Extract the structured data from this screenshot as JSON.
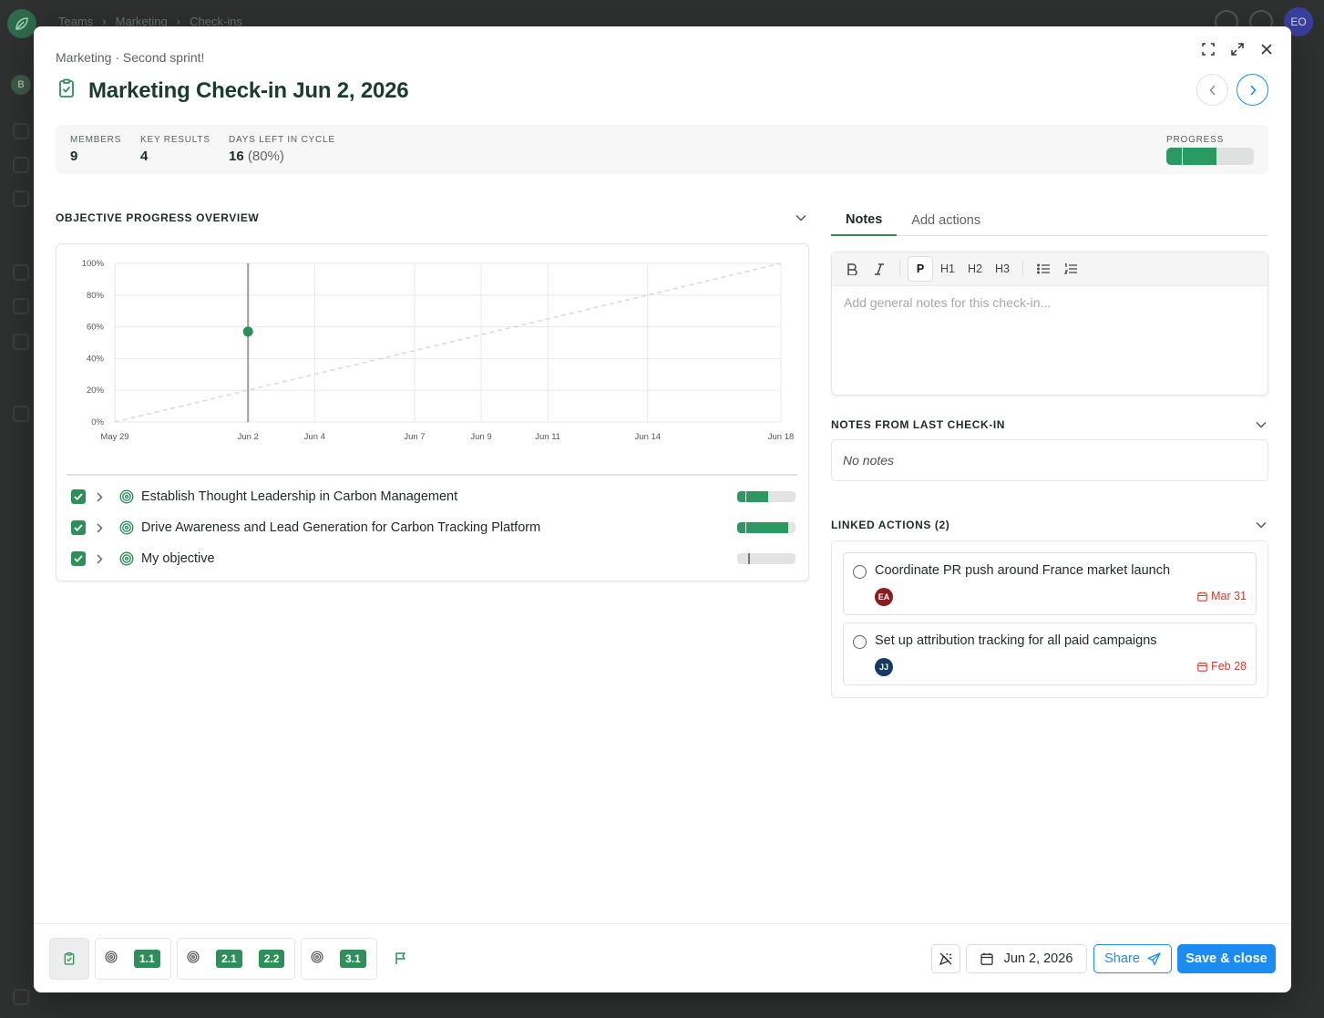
{
  "background": {
    "breadcrumbs": [
      "Teams",
      "Marketing",
      "Check-ins"
    ],
    "user_initials": "EO",
    "workspace_initial": "B"
  },
  "modal": {
    "subtitle": "Marketing · Second sprint!",
    "title": "Marketing Check-in Jun 2, 2026"
  },
  "stats": {
    "members_label": "MEMBERS",
    "members_value": "9",
    "key_results_label": "KEY RESULTS",
    "key_results_value": "4",
    "days_left_label": "DAYS LEFT IN CYCLE",
    "days_left_value": "16",
    "days_left_pct": "(80%)",
    "progress_label": "PROGRESS",
    "progress_fraction": 0.57
  },
  "overview": {
    "title": "OBJECTIVE PROGRESS OVERVIEW",
    "objectives": [
      {
        "label": "Establish Thought Leadership in Carbon Management",
        "progress": 0.53
      },
      {
        "label": "Drive Awareness and Lead Generation for Carbon Tracking Platform",
        "progress": 0.88
      },
      {
        "label": "My objective",
        "progress": 0.0
      }
    ]
  },
  "chart_data": {
    "type": "line",
    "x_ticks": [
      "May 29",
      "Jun 2",
      "Jun 4",
      "Jun 7",
      "Jun 9",
      "Jun 11",
      "Jun 14",
      "Jun 18"
    ],
    "y_ticks": [
      "100%",
      "80%",
      "60%",
      "40%",
      "20%",
      "0%"
    ],
    "ylim": [
      0,
      100
    ],
    "xlim": [
      "May 29",
      "Jun 18"
    ],
    "grid": true,
    "series": [
      {
        "style": "dashed",
        "color": "#d9dcdb",
        "points": [
          {
            "x": "May 29",
            "y": 0
          },
          {
            "x": "Jun 18",
            "y": 100
          }
        ]
      },
      {
        "style": "point",
        "color": "#2e8f5a",
        "points": [
          {
            "x": "Jun 2",
            "y": 57
          }
        ]
      }
    ],
    "current_date_marker": "Jun 2"
  },
  "tabs": {
    "notes": "Notes",
    "add_actions": "Add actions"
  },
  "editor": {
    "bold": "B",
    "italic": "I",
    "p": "P",
    "h1": "H1",
    "h2": "H2",
    "h3": "H3",
    "placeholder": "Add general notes for this check-in..."
  },
  "notes_last": {
    "title": "NOTES FROM LAST CHECK-IN",
    "empty": "No notes"
  },
  "linked": {
    "title": "LINKED ACTIONS (2)",
    "actions": [
      {
        "label": "Coordinate PR push around France market launch",
        "assignee": "EA",
        "assignee_color": "#8b1d22",
        "due": "Mar 31"
      },
      {
        "label": "Set up attribution tracking for all paid campaigns",
        "assignee": "JJ",
        "assignee_color": "#173a63",
        "due": "Feb 28"
      }
    ]
  },
  "footer": {
    "kr_groups": [
      [
        "1.1"
      ],
      [
        "2.1",
        "2.2"
      ],
      [
        "3.1"
      ]
    ],
    "date": "Jun 2, 2026",
    "share": "Share",
    "save": "Save & close"
  },
  "colors": {
    "accent_green": "#2e8f5a",
    "primary_blue": "#1d8cf0",
    "due_red": "#d33b2c"
  }
}
